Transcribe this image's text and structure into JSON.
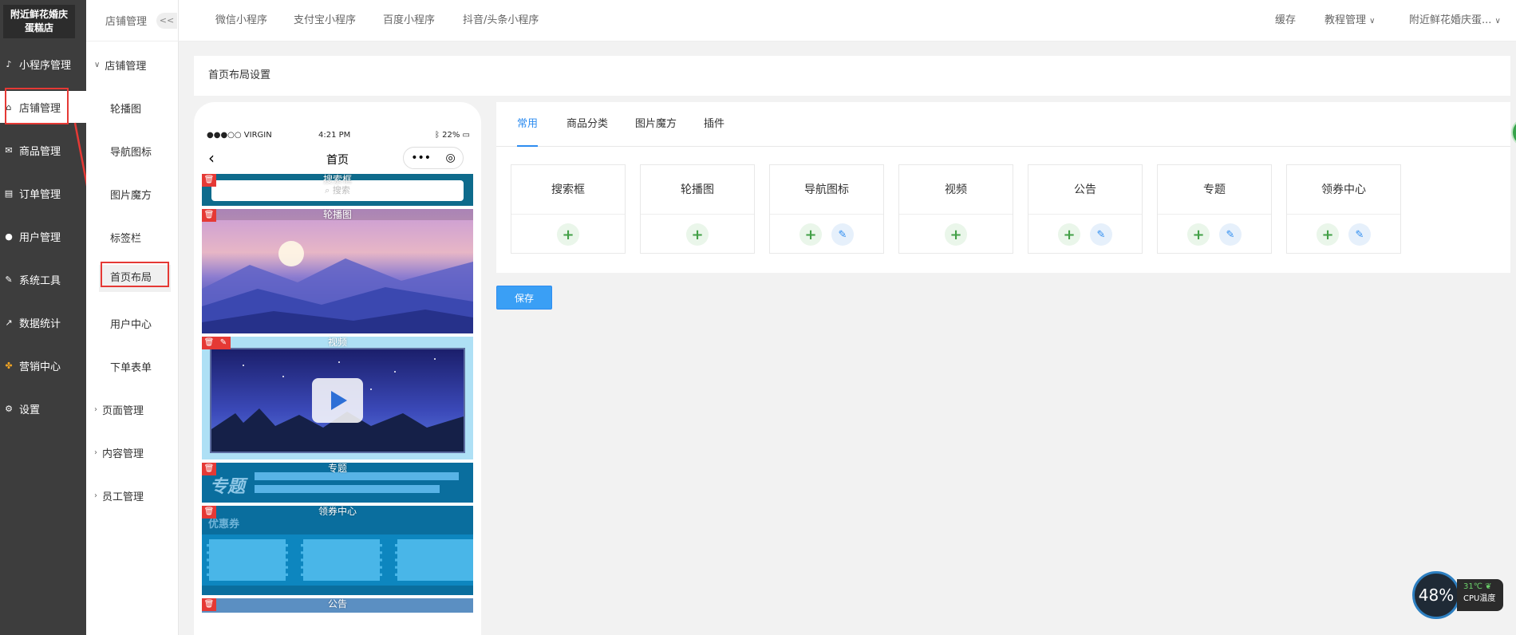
{
  "brand": {
    "line1": "附近鲜花婚庆",
    "line2": "蛋糕店"
  },
  "sidebar": {
    "items": [
      {
        "label": "小程序管理",
        "icon": "miniprogram-icon"
      },
      {
        "label": "店铺管理",
        "icon": "store-icon"
      },
      {
        "label": "商品管理",
        "icon": "goods-icon"
      },
      {
        "label": "订单管理",
        "icon": "order-icon"
      },
      {
        "label": "用户管理",
        "icon": "user-icon"
      },
      {
        "label": "系统工具",
        "icon": "wrench-icon"
      },
      {
        "label": "数据统计",
        "icon": "chart-icon"
      },
      {
        "label": "营销中心",
        "icon": "marketing-icon"
      },
      {
        "label": "设置",
        "icon": "gear-icon"
      }
    ]
  },
  "submenu": {
    "header": "店铺管理",
    "collapse": "<<",
    "group_open": "店铺管理",
    "items": [
      "轮播图",
      "导航图标",
      "图片魔方",
      "标签栏",
      "首页布局",
      "用户中心",
      "下单表单"
    ],
    "groups_closed": [
      "页面管理",
      "内容管理",
      "员工管理"
    ]
  },
  "topnav": {
    "tabs": [
      "微信小程序",
      "支付宝小程序",
      "百度小程序",
      "抖音/头条小程序"
    ],
    "cache": "缓存",
    "tutorial": "教程管理",
    "account": "附近鲜花婚庆蛋..."
  },
  "page_title": "首页布局设置",
  "phone": {
    "carrier": "●●●○○ VIRGIN",
    "time": "4:21 PM",
    "battery": "22%",
    "title": "首页",
    "blocks": {
      "search": "搜索框",
      "search_placeholder": "搜索",
      "banner": "轮播图",
      "video": "视频",
      "topic": "专题",
      "topic_art": "专题",
      "coupon": "领券中心",
      "coupon_art": "优惠券",
      "notice": "公告"
    }
  },
  "panel": {
    "tabs": [
      "常用",
      "商品分类",
      "图片魔方",
      "插件"
    ],
    "cards": [
      {
        "label": "搜索框",
        "edit": false
      },
      {
        "label": "轮播图",
        "edit": false
      },
      {
        "label": "导航图标",
        "edit": true
      },
      {
        "label": "视频",
        "edit": false
      },
      {
        "label": "公告",
        "edit": true
      },
      {
        "label": "专题",
        "edit": true
      },
      {
        "label": "领券中心",
        "edit": true
      }
    ]
  },
  "save_label": "保存",
  "cpu": {
    "percent": "48%",
    "temp": "31℃",
    "label": "CPU温度"
  }
}
